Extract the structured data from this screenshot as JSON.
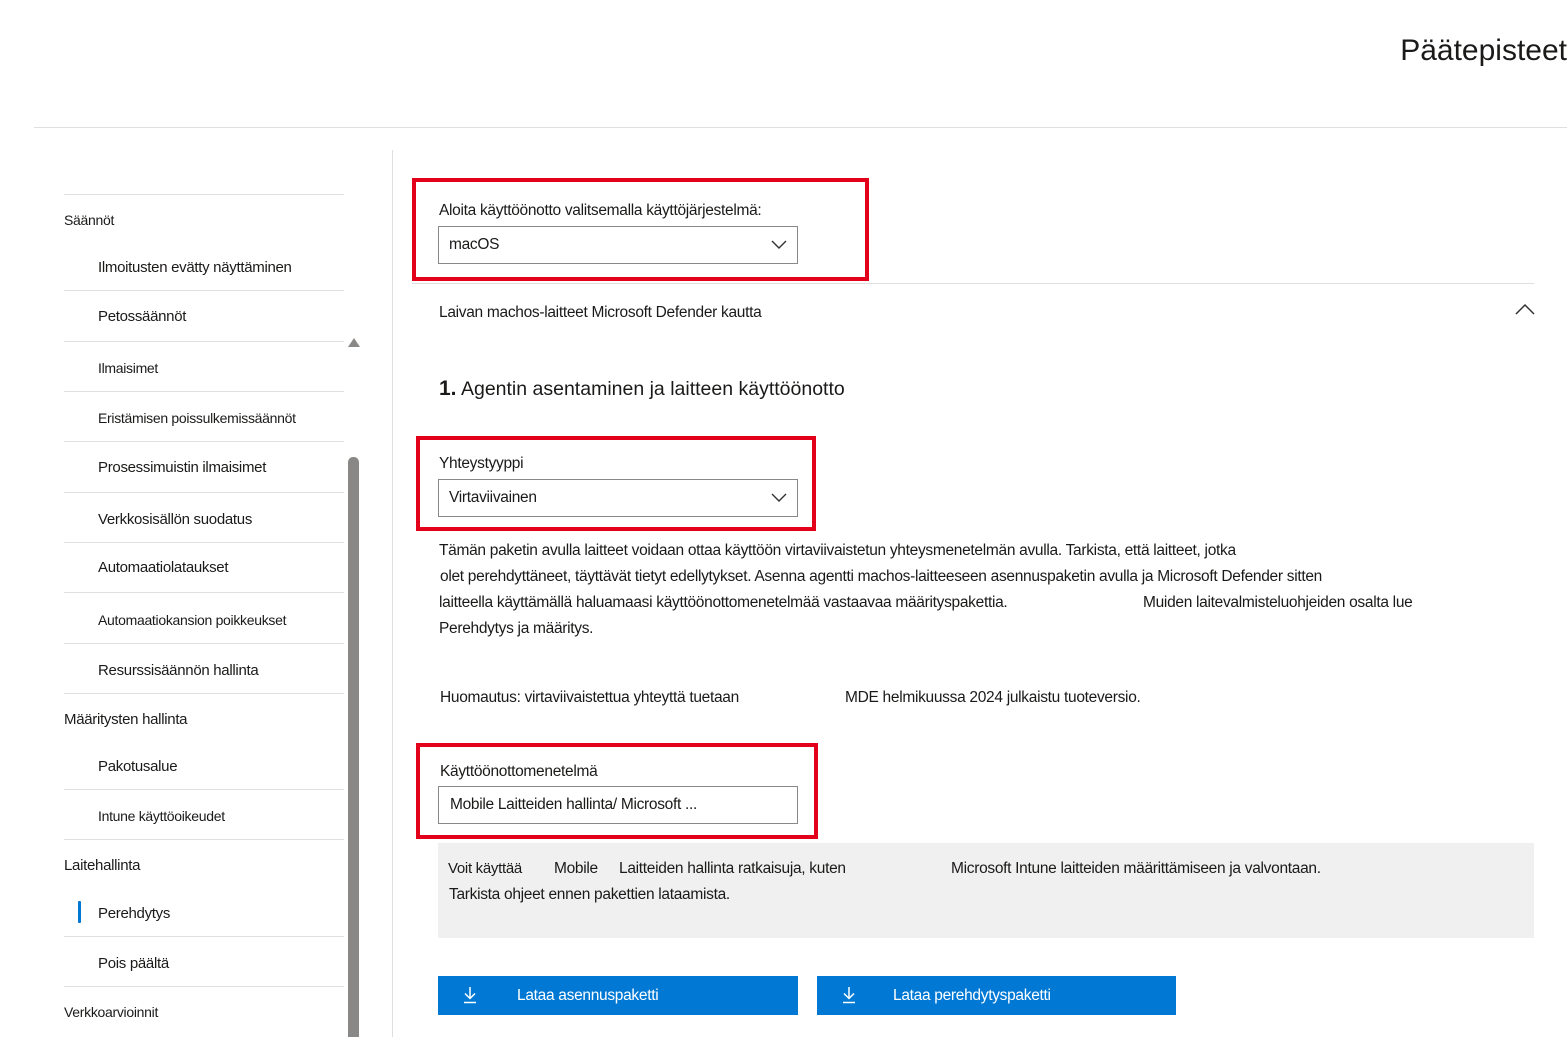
{
  "header": {
    "title": "Päätepisteet"
  },
  "sidebar": {
    "items": [
      {
        "label": "Säännöt"
      },
      {
        "label": "Ilmoitusten evätty näyttäminen"
      },
      {
        "label": "Petossäännöt"
      },
      {
        "label": "Ilmaisimet"
      },
      {
        "label": "Eristämisen poissulkemissäännöt"
      },
      {
        "label": "Prosessimuistin ilmaisimet"
      },
      {
        "label": "Verkkosisällön suodatus"
      },
      {
        "label": "Automaatiolataukset"
      },
      {
        "label": "Automaatiokansion poikkeukset"
      },
      {
        "label": "Resurssisäännön hallinta"
      },
      {
        "label": "Määritysten hallinta"
      },
      {
        "label": "Pakotusalue"
      },
      {
        "label": "Intune käyttöoikeudet"
      },
      {
        "label": "Laitehallinta"
      },
      {
        "label": "Perehdytys"
      },
      {
        "label": "Pois päältä"
      },
      {
        "label": "Verkkoarvioinnit"
      }
    ],
    "selected": "Perehdytys"
  },
  "main": {
    "os_label": "Aloita käyttöönotto valitsemalla käyttöjärjestelmä:",
    "os_value": "macOS",
    "section_title": "Laivan machos-laitteet Microsoft Defender kautta",
    "step_number": "1.",
    "step_title": "Agentin asentaminen ja laitteen käyttöönotto",
    "connection_label": "Yhteystyyppi",
    "connection_value": "Virtaviivainen",
    "desc_line1": "Tämän paketin avulla laitteet voidaan ottaa käyttöön virtaviivaistetun yhteysmenetelmän avulla. Tarkista, että laitteet, jotka",
    "desc_line2": "olet perehdyttäneet, täyttävät tietyt edellytykset. Asenna agentti machos-laitteeseen asennuspaketin avulla ja Microsoft Defender sitten",
    "desc_line3a": "laitteella käyttämällä haluamaasi käyttöönottomenetelmää vastaavaa määrityspakettia.",
    "desc_line3b": "Muiden laitevalmisteluohjeiden osalta lue",
    "desc_line4": "Perehdytys ja määritys.",
    "note_a": "Huomautus: virtaviivaistettua yhteyttä tuetaan",
    "note_b": "MDE helmikuussa 2024 julkaistu tuoteversio.",
    "method_label": "Käyttöönottomenetelmä",
    "method_value": "Mobile Laitteiden hallinta/ Microsoft ...",
    "info_a": "Voit käyttää",
    "info_b": "Mobile",
    "info_c": "Laitteiden hallinta ratkaisuja, kuten",
    "info_d": "Microsoft Intune laitteiden määrittämiseen ja valvontaan.",
    "info_line2": "Tarkista ohjeet ennen pakettien lataamista.",
    "btn_install": "Lataa asennuspaketti",
    "btn_onboard": "Lataa perehdytyspaketti"
  },
  "colors": {
    "accent": "#0078d4",
    "highlight": "#e3001b",
    "info_bg": "#f0f0f0"
  },
  "icons": [
    "chevron-down-icon",
    "chevron-up-icon",
    "download-icon"
  ]
}
